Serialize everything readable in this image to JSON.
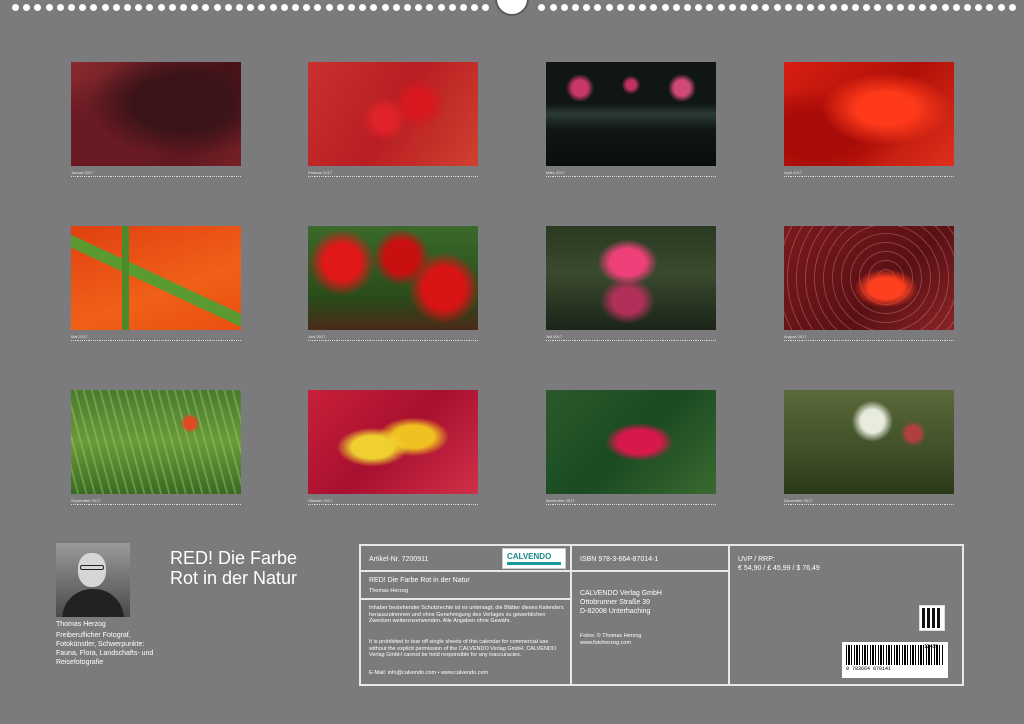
{
  "months": [
    {
      "label": "Januar 2017"
    },
    {
      "label": "Februar 2017"
    },
    {
      "label": "März 2017"
    },
    {
      "label": "April 2017"
    },
    {
      "label": "Mai 2017"
    },
    {
      "label": "Juni 2017"
    },
    {
      "label": "Juli 2017"
    },
    {
      "label": "August 2017"
    },
    {
      "label": "September 2017"
    },
    {
      "label": "Oktober 2017"
    },
    {
      "label": "November 2017"
    },
    {
      "label": "Dezember 2017"
    }
  ],
  "author": {
    "name": "Thomas Herzog",
    "description": "Freiberuflicher Fotograf, Fotokünstler, Schwerpunkte: Fauna, Flora, Landschafts- und Reisefotografie"
  },
  "title": {
    "line1": "RED! Die Farbe",
    "line2": "Rot in der Natur"
  },
  "info": {
    "article": "Artikel-Nr. 7200911",
    "brand": "CALVENDO",
    "product_title": "RED! Die Farbe Rot in der Natur",
    "product_author": "Thomas Herzog",
    "rights_de": "Inhaber bestehender Schutzrechte ist es untersagt, die Blätter dieses Kalenders herauszutrennen und ohne Genehmigung des Verlages zu gewerblichen Zwecken weiterzuverwenden. Alle Angaben ohne Gewähr.",
    "rights_en": "It is prohibited to tear off single sheets of this calendar for commercial use without the explicit permission of the CALVENDO Verlag GmbH. CALVENDO Verlag GmbH cannot be held responsible for any inaccuracies.",
    "email": "E-Mail: info@calvendo.com • www.calvendo.com",
    "isbn": "ISBN 978-3-664-87014-1",
    "publisher": "CALVENDO Verlag GmbH",
    "street": "Ottobrunner Straße 39",
    "city": "D-82008 Unterhaching",
    "photos": "Fotos: © Thomas Herzog",
    "website": "www.fotoherzog.com",
    "price_label": "UVP / RRP:",
    "price": "€ 54,90 / £ 45,99 / $ 76,49",
    "barcode_number": "9 783664 870141",
    "barcode_code": "12489"
  }
}
